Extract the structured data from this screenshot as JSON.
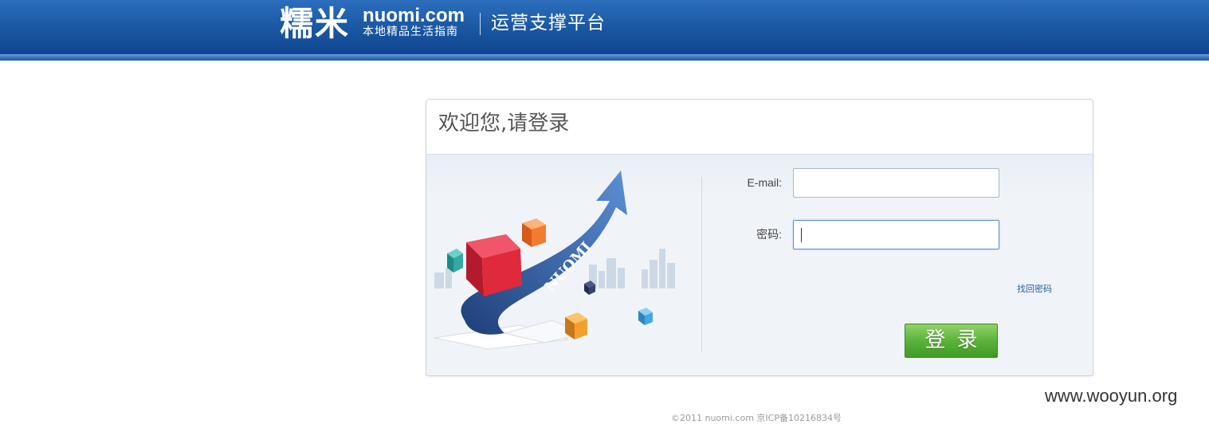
{
  "header": {
    "logo_cn": "糯米",
    "logo_en": "nuomi.com",
    "logo_tagline": "本地精品生活指南",
    "platform_title": "运营支撑平台"
  },
  "login": {
    "title": "欢迎您,请登录",
    "email_label": "E-mail:",
    "email_value": "",
    "password_label": "密码:",
    "password_value": "",
    "forgot_password": "找回密码",
    "submit_label": "登录",
    "illustration_text": "NUOMI"
  },
  "footer": {
    "copyright": "©2011 nuomi.com 京ICP备10216834号"
  },
  "watermark": "www.wooyun.org",
  "colors": {
    "header_blue": "#1c5aa5",
    "button_green": "#5bb33a",
    "link_blue": "#2b5fa6"
  }
}
